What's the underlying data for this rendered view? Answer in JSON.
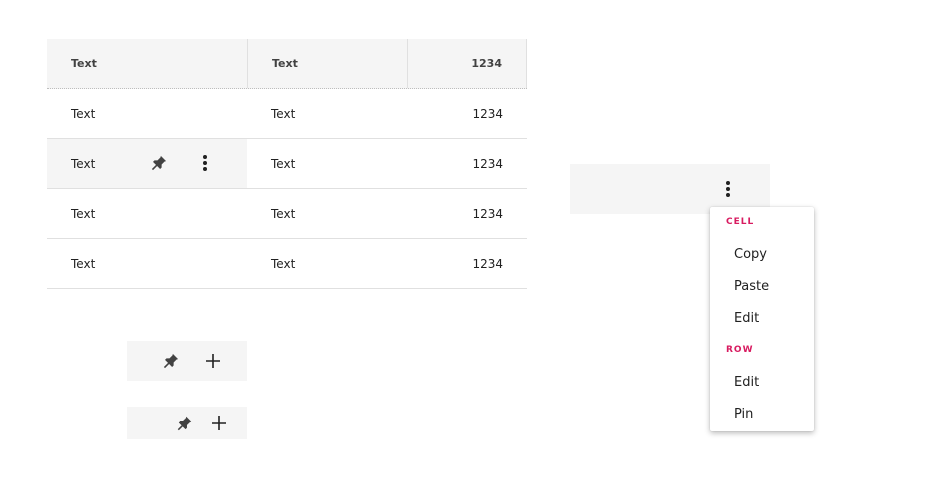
{
  "table": {
    "header": [
      "Text",
      "Text",
      "1234"
    ],
    "rows": [
      [
        "Text",
        "Text",
        "1234"
      ],
      [
        "Text",
        "Text",
        "1234"
      ],
      [
        "Text",
        "Text",
        "1234"
      ],
      [
        "Text",
        "Text",
        "1234"
      ]
    ]
  },
  "menu": {
    "cell_label": "CELL",
    "cell_items": [
      "Copy",
      "Paste",
      "Edit"
    ],
    "row_label": "ROW",
    "row_items": [
      "Edit",
      "Pin"
    ]
  },
  "icons": {
    "pin": "pin-icon",
    "more": "more-vert-icon",
    "add": "plus-icon"
  },
  "colors": {
    "accent": "#d81b60",
    "hover_bg": "#f5f5f5",
    "divider": "#e0e0e0"
  }
}
